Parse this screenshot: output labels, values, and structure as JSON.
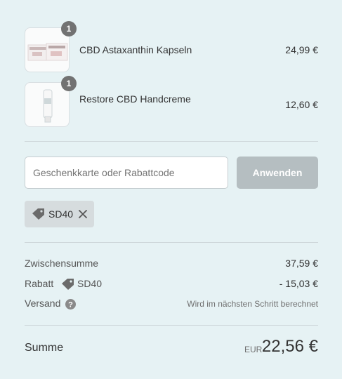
{
  "cart": {
    "items": [
      {
        "name": "CBD Astaxanthin Kapseln",
        "price": "24,99 €",
        "quantity": "1",
        "icon": "capsule-box-image"
      },
      {
        "name": "Restore CBD Handcreme",
        "price": "12,60 €",
        "quantity": "1",
        "icon": "cream-tube-image"
      }
    ]
  },
  "discount": {
    "placeholder": "Geschenkkarte oder Rabattcode",
    "value": "",
    "apply_label": "Anwenden",
    "applied_code": "SD40"
  },
  "summary": {
    "subtotal_label": "Zwischensumme",
    "subtotal_value": "37,59 €",
    "discount_label": "Rabatt",
    "discount_code": "SD40",
    "discount_value": "- 15,03 €",
    "shipping_label": "Versand",
    "shipping_value": "Wird im nächsten Schritt berechnet",
    "total_label": "Summe",
    "currency": "EUR",
    "total_value": "22,56 €"
  },
  "colors": {
    "background": "#e6f2f4",
    "button_disabled": "#b5bec1",
    "badge": "#727272",
    "tag_bg": "#d6dcde"
  }
}
